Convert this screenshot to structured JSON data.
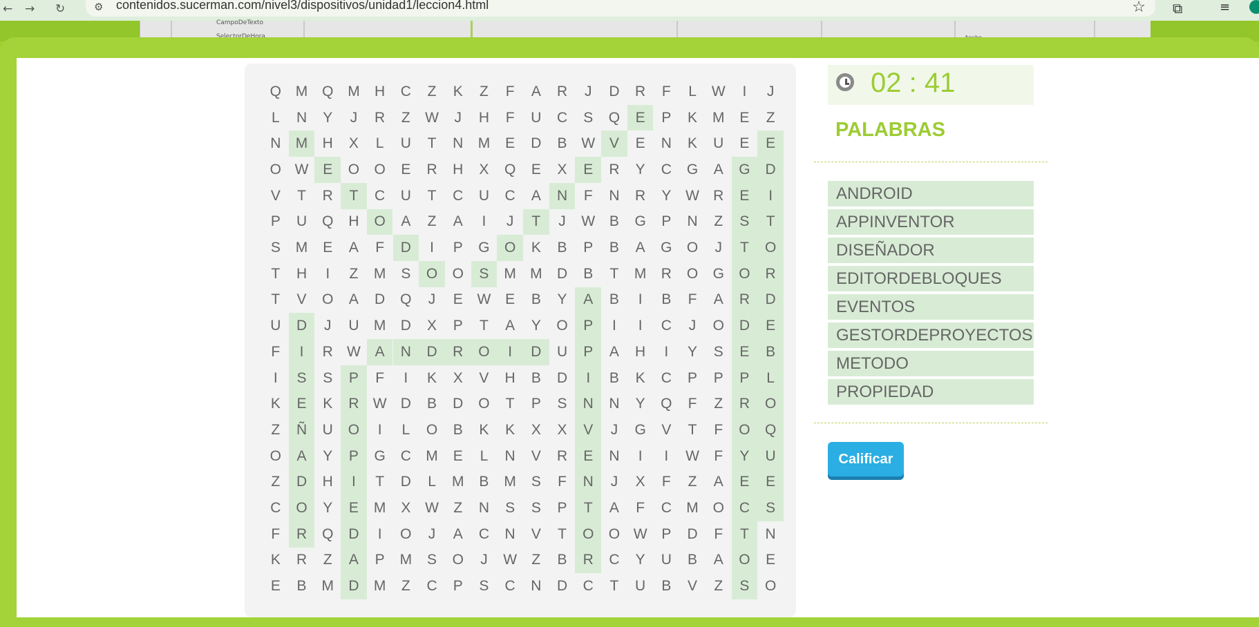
{
  "browser": {
    "url": "contenidos.sucerman.com/nivel3/dispositivos/unidad1/leccion4.html"
  },
  "background_screenshot": {
    "label_1": "CampoDeTexto",
    "label_2": "SelectorDeHora",
    "label_3": "Ancho"
  },
  "game": {
    "timer": "02 : 41",
    "words_title": "PALABRAS",
    "words": [
      "ANDROID",
      "APPINVENTOR",
      "DISEÑADOR",
      "EDITORDEBLOQUES",
      "EVENTOS",
      "GESTORDEPROYECTOS",
      "METODO",
      "PROPIEDAD"
    ],
    "grade_button": "Calificar",
    "grid": [
      "QMQMHCZKZFARJDRFLWIJ",
      "LNYJRZWJHFUCSQEPKMEZ",
      "NMHXLUTNMEDBWVENKUEE",
      "OWEOOERHXQEXERYCGAGD",
      "VTRTCUTCUCANFNRYWREI",
      "PUQHOAZAIJTJWBGPNZST",
      "SMEAFDIPGOKBPBAGOJTO",
      "THIZMSOOSMMDBTMROGOR",
      "TVOADQJEWEBYABIBFARD",
      "UDJUMDXPTAYOPIICJODE",
      "FIRWANDROIDUPAHIYSEB",
      "ISSPFIKXVHBDIBKCPPPL",
      "KEKRWDBDOTPSNNYQFZRO",
      "ZÑUOILOBKKXXVJGVTFOQ",
      "OAYPGCMELNVRENIIWFYU",
      "ZDHITDLMBMSFNJXFZAEE",
      "COYEMXWZNSSPTAFCMOCS",
      "FRQDIOJACNVTOOWPDFTN",
      "KRZAPMSOJWZBRCYUBAOE",
      "EBMDMZCPSCNDCTUBVZSO"
    ],
    "found_cells": [
      [
        1,
        14
      ],
      [
        2,
        13
      ],
      [
        3,
        12
      ],
      [
        4,
        11
      ],
      [
        2,
        1
      ],
      [
        3,
        2
      ],
      [
        4,
        3
      ],
      [
        5,
        4
      ],
      [
        6,
        5
      ],
      [
        7,
        6
      ],
      [
        7,
        8
      ],
      [
        6,
        9
      ],
      [
        5,
        10
      ],
      [
        4,
        11
      ],
      [
        2,
        19
      ],
      [
        3,
        19
      ],
      [
        4,
        19
      ],
      [
        5,
        19
      ],
      [
        6,
        19
      ],
      [
        7,
        19
      ],
      [
        8,
        19
      ],
      [
        9,
        19
      ],
      [
        10,
        19
      ],
      [
        11,
        19
      ],
      [
        12,
        19
      ],
      [
        13,
        19
      ],
      [
        14,
        19
      ],
      [
        15,
        19
      ],
      [
        16,
        19
      ],
      [
        3,
        18
      ],
      [
        4,
        18
      ],
      [
        5,
        18
      ],
      [
        6,
        18
      ],
      [
        7,
        18
      ],
      [
        8,
        18
      ],
      [
        9,
        18
      ],
      [
        10,
        18
      ],
      [
        11,
        18
      ],
      [
        12,
        18
      ],
      [
        13,
        18
      ],
      [
        14,
        18
      ],
      [
        15,
        18
      ],
      [
        16,
        18
      ],
      [
        17,
        18
      ],
      [
        18,
        18
      ],
      [
        19,
        18
      ],
      [
        8,
        12
      ],
      [
        9,
        12
      ],
      [
        10,
        12
      ],
      [
        11,
        12
      ],
      [
        12,
        12
      ],
      [
        13,
        12
      ],
      [
        14,
        12
      ],
      [
        15,
        12
      ],
      [
        16,
        12
      ],
      [
        17,
        12
      ],
      [
        18,
        12
      ],
      [
        10,
        4
      ],
      [
        10,
        5
      ],
      [
        10,
        6
      ],
      [
        10,
        7
      ],
      [
        10,
        8
      ],
      [
        10,
        9
      ],
      [
        10,
        10
      ],
      [
        9,
        1
      ],
      [
        10,
        1
      ],
      [
        11,
        1
      ],
      [
        12,
        1
      ],
      [
        13,
        1
      ],
      [
        14,
        1
      ],
      [
        15,
        1
      ],
      [
        16,
        1
      ],
      [
        17,
        1
      ],
      [
        11,
        3
      ],
      [
        12,
        3
      ],
      [
        13,
        3
      ],
      [
        14,
        3
      ],
      [
        15,
        3
      ],
      [
        16,
        3
      ],
      [
        17,
        3
      ],
      [
        18,
        3
      ],
      [
        19,
        3
      ]
    ]
  }
}
